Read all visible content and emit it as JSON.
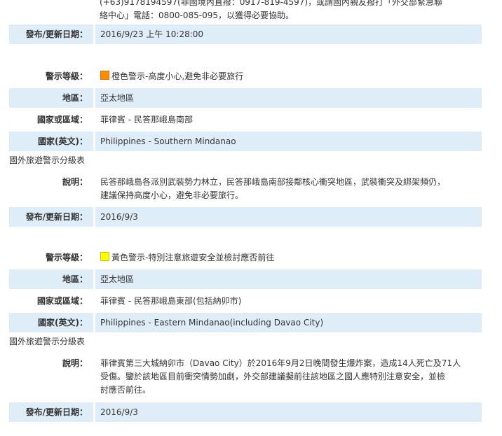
{
  "top_note": {
    "line1": "(+63)9178194597(菲國境內直撥：0917-819-4597)，或請國內親友撥打「外交部緊急聯",
    "line2": "絡中心」電話：0800-085-095，以獲得必要協助。"
  },
  "labels": {
    "level": "警示等級：",
    "region": "地區：",
    "country": "國家或區域：",
    "country_en": "國家(英文)：",
    "desc": "說明：",
    "date": "發布/更新日期："
  },
  "first_date": "2016/9/23 上午 10:28:00",
  "entries": [
    {
      "level_color": "#ff8c00",
      "level_text": "橙色警示-高度小心,避免非必要旅行",
      "region": "亞太地區",
      "country": "菲律賓 - 民答那峨島南部",
      "country_en": "Philippines - Southern Mindanao",
      "link": "國外旅遊警示分級表",
      "desc_lines": [
        "民答那峨島各派別武裝勢力林立，民答那峨島南部接鄰核心衝突地區，武裝衝突及綁架頻仍，",
        "建議保持高度小心，避免非必要旅行。"
      ],
      "date": "2016/9/3"
    },
    {
      "level_color": "#ffff00",
      "level_text": "黃色警示-特別注意旅遊安全並檢討應否前往",
      "region": "亞太地區",
      "country": "菲律賓 - 民答那峨島東部(包括納卯市)",
      "country_en": "Philippines - Eastern Mindanao(including Davao City)",
      "link": "國外旅遊警示分級表",
      "desc_lines": [
        "菲律賓第三大城納卯市（Davao City）於2016年9月2日晚間發生爆炸案，造成14人死亡及71人",
        "受傷。鑒於該地區目前衝突情勢加劇，外交部建議擬前往該地區之國人應特別注意安全，並檢",
        "討應否前往。"
      ],
      "date": "2016/9/3"
    }
  ]
}
